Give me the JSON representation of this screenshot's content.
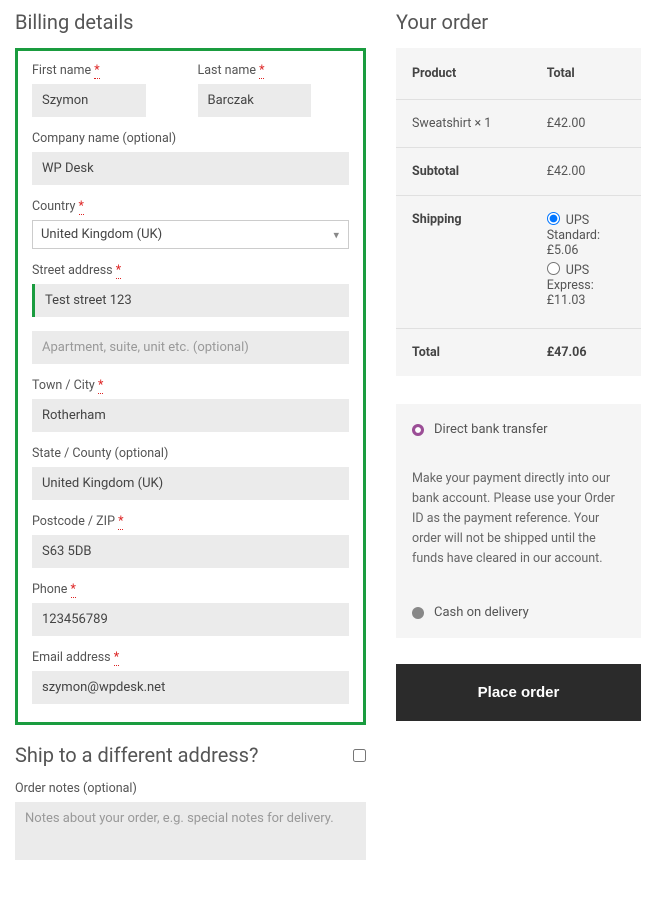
{
  "billing": {
    "heading": "Billing details",
    "first_name_label": "First name",
    "first_name_value": "Szymon",
    "last_name_label": "Last name",
    "last_name_value": "Barczak",
    "company_label": "Company name (optional)",
    "company_value": "WP Desk",
    "country_label": "Country",
    "country_value": "United Kingdom (UK)",
    "street_label": "Street address",
    "street_value": "Test street 123",
    "apt_placeholder": "Apartment, suite, unit etc. (optional)",
    "city_label": "Town / City",
    "city_value": "Rotherham",
    "state_label": "State / County (optional)",
    "state_value": "United Kingdom (UK)",
    "postcode_label": "Postcode / ZIP",
    "postcode_value": "S63 5DB",
    "phone_label": "Phone",
    "phone_value": "123456789",
    "email_label": "Email address",
    "email_value": "szymon@wpdesk.net"
  },
  "shipping": {
    "heading": "Ship to a different address?",
    "notes_label": "Order notes (optional)",
    "notes_placeholder": "Notes about your order, e.g. special notes for delivery."
  },
  "order": {
    "heading": "Your order",
    "col_product": "Product",
    "col_total": "Total",
    "items": [
      {
        "name": "Sweatshirt",
        "qty": "× 1",
        "price": "£42.00"
      }
    ],
    "subtotal_label": "Subtotal",
    "subtotal_value": "£42.00",
    "shipping_label": "Shipping",
    "shipping_options": [
      {
        "label": "UPS Standard:",
        "price": "£5.06",
        "selected": true
      },
      {
        "label": "UPS Express:",
        "price": "£11.03",
        "selected": false
      }
    ],
    "total_label": "Total",
    "total_value": "£47.06"
  },
  "payment": {
    "methods": [
      {
        "id": "bank",
        "label": "Direct bank transfer",
        "selected": true
      },
      {
        "id": "cod",
        "label": "Cash on delivery",
        "selected": false
      }
    ],
    "bank_desc": "Make your payment directly into our bank account. Please use your Order ID as the payment reference. Your order will not be shipped until the funds have cleared in our account.",
    "place_order_label": "Place order"
  },
  "required_mark": "*"
}
